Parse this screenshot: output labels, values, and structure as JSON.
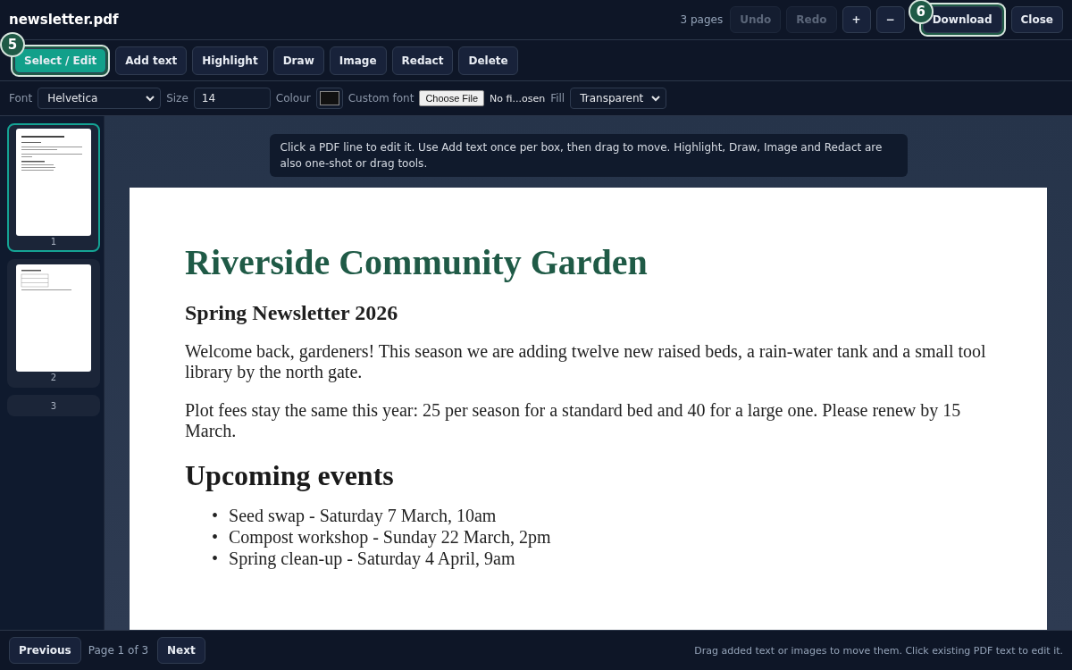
{
  "title": "newsletter.pdf",
  "header": {
    "page_count": "3 pages",
    "buttons": [
      {
        "label": "Undo",
        "disabled": true
      },
      {
        "label": "Redo",
        "disabled": true
      },
      {
        "label": "+",
        "disabled": false
      },
      {
        "label": "−",
        "disabled": false
      },
      {
        "label": "Download",
        "disabled": false,
        "callout": "6"
      },
      {
        "label": "Close",
        "disabled": false
      }
    ]
  },
  "tools": [
    {
      "label": "Select / Edit",
      "selected": true,
      "callout": "5"
    },
    {
      "label": "Add text",
      "selected": false
    },
    {
      "label": "Highlight",
      "selected": false
    },
    {
      "label": "Draw",
      "selected": false
    },
    {
      "label": "Image",
      "selected": false
    },
    {
      "label": "Redact",
      "selected": false
    },
    {
      "label": "Delete",
      "selected": false
    }
  ],
  "format": {
    "font_label": "Font",
    "font": "Helvetica",
    "size_label": "Size",
    "size": "14",
    "colour_label": "Colour",
    "custom_font_label": "Custom font",
    "file_button": "Choose File",
    "file_status": "No fi...osen",
    "fill_label": "Fill",
    "fill": "Transparent"
  },
  "hint": "Click a PDF line to edit it. Use Add text once per box, then drag to move. Highlight, Draw, Image and Redact are also one-shot or drag tools.",
  "pages": [
    {
      "label": "1",
      "selected": true,
      "kind": "cover"
    },
    {
      "label": "2",
      "selected": false,
      "kind": "table"
    },
    {
      "label": "3",
      "selected": false,
      "kind": "empty"
    }
  ],
  "document": {
    "title": "Riverside Community Garden",
    "subtitle": "Spring Newsletter 2026",
    "paragraphs": [
      "Welcome back, gardeners! This season we are adding twelve new raised beds, a rain-water tank and a small tool library by the north gate.",
      "Plot fees stay the same this year: 25 per season for a standard bed and 40 for a large one. Please renew by 15 March."
    ],
    "events_heading": "Upcoming events",
    "events": [
      {
        "marker": "•",
        "text": "Seed swap - Saturday 7 March, 10am"
      },
      {
        "marker": "•",
        "text": "Compost workshop - Sunday 22 March, 2pm"
      },
      {
        "marker": "•",
        "text": "Spring clean-up - Saturday 4 April, 9am"
      }
    ]
  },
  "footer": {
    "previous": "Previous",
    "page_status": "Page 1 of 3",
    "next": "Next",
    "help": "Drag added text or images to move them. Click existing PDF text to edit it."
  }
}
